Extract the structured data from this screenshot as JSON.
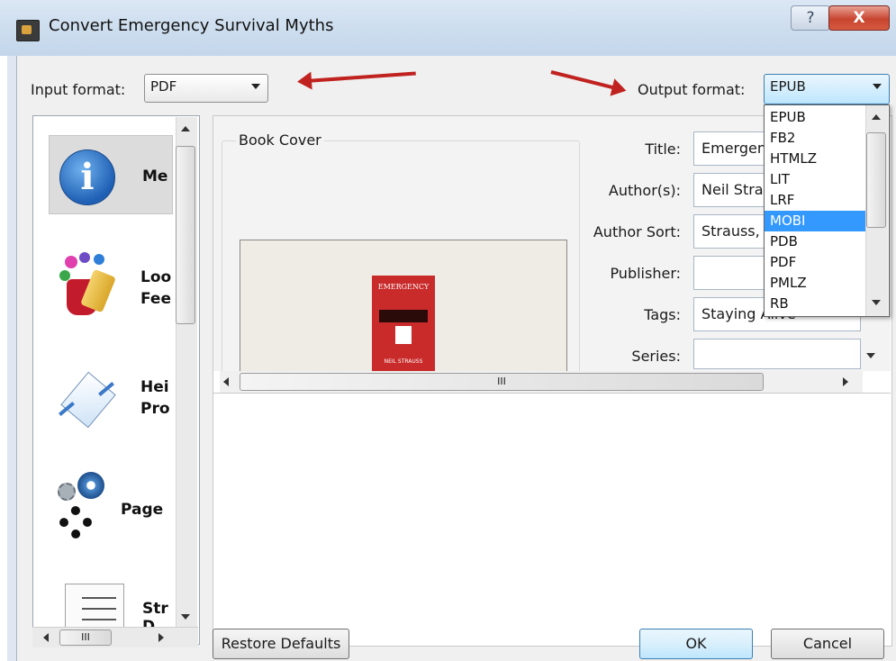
{
  "window": {
    "title": "Convert Emergency Survival Myths",
    "help": "?",
    "close": "X"
  },
  "input_format": {
    "label": "Input format:",
    "value": "PDF"
  },
  "output_format": {
    "label": "Output format:",
    "value": "EPUB",
    "options": [
      "EPUB",
      "FB2",
      "HTMLZ",
      "LIT",
      "LRF",
      "MOBI",
      "PDB",
      "PDF",
      "PMLZ",
      "RB"
    ],
    "highlighted": "MOBI"
  },
  "sidebar": {
    "items": [
      {
        "label": "Me",
        "icon": "info-icon"
      },
      {
        "label": "Loo\nFee",
        "icon": "paint-bucket-icon"
      },
      {
        "label": "Hei\nPro",
        "icon": "page-rotate-icon"
      },
      {
        "label": "Page",
        "icon": "gears-icon"
      },
      {
        "label": "Str\nD",
        "icon": "document-lines-icon"
      }
    ]
  },
  "metadata": {
    "cover_label": "Book Cover",
    "book_cover_text": "EMERGENCY",
    "book_author_text": "NEIL STRAUSS",
    "fields": [
      {
        "label": "Title:",
        "value": "Emergen"
      },
      {
        "label": "Author(s):",
        "value": "Neil Stra"
      },
      {
        "label": "Author Sort:",
        "value": "Strauss,"
      },
      {
        "label": "Publisher:",
        "value": ""
      },
      {
        "label": "Tags:",
        "value": "Staying Alive"
      },
      {
        "label": "Series:",
        "value": ""
      }
    ]
  },
  "scrollbar_grip": "III",
  "buttons": {
    "restore": "Restore Defaults",
    "ok": "OK",
    "cancel": "Cancel"
  },
  "colors": {
    "selection": "#3399ff",
    "arrow": "#c0221f",
    "close": "#c8452f"
  }
}
